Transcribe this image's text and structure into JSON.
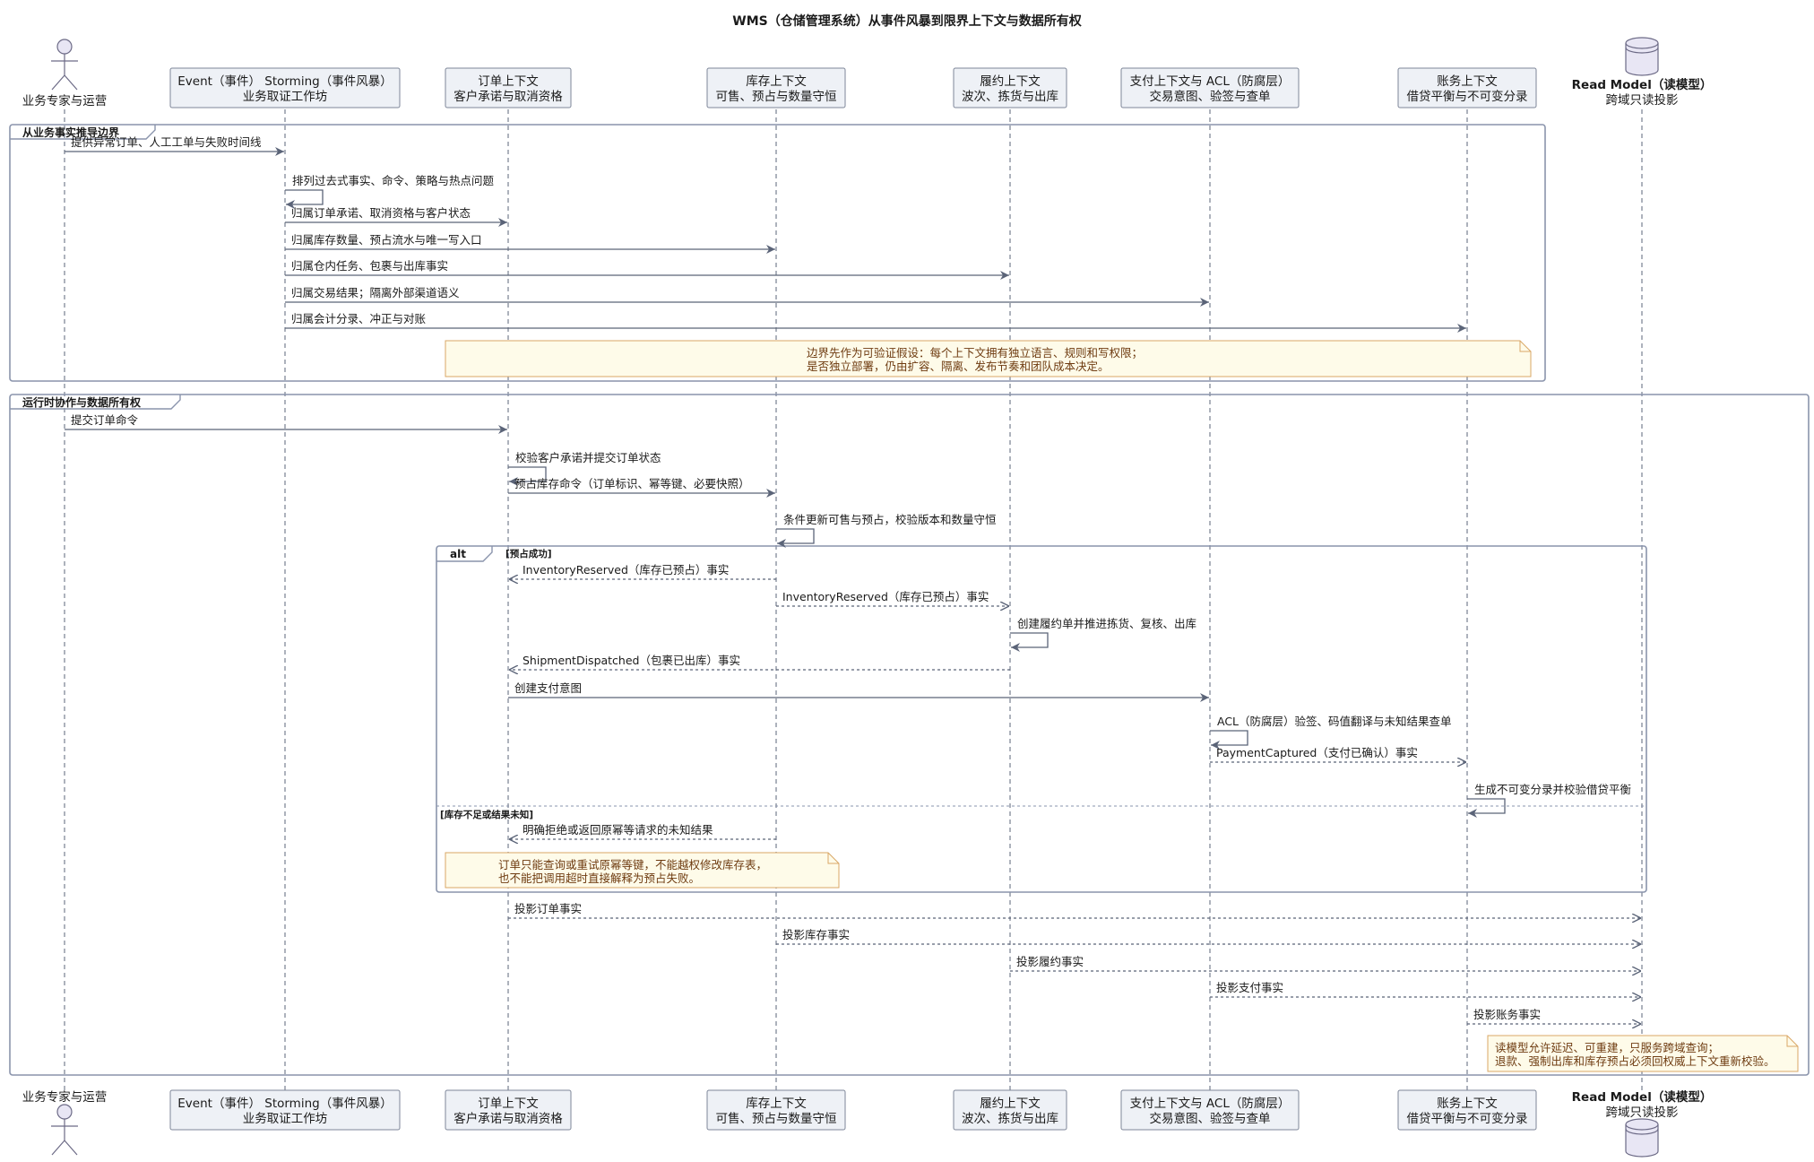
{
  "title": "WMS（仓储管理系统）从事件风暴到限界上下文与数据所有权",
  "participants": [
    {
      "id": "expert",
      "kind": "actor",
      "lines": [
        "业务专家与运营"
      ]
    },
    {
      "id": "es",
      "kind": "box",
      "lines": [
        "Event（事件） Storming（事件风暴）",
        "业务取证工作坊"
      ]
    },
    {
      "id": "order",
      "kind": "box",
      "lines": [
        "订单上下文",
        "客户承诺与取消资格"
      ]
    },
    {
      "id": "inv",
      "kind": "box",
      "lines": [
        "库存上下文",
        "可售、预占与数量守恒"
      ]
    },
    {
      "id": "ful",
      "kind": "box",
      "lines": [
        "履约上下文",
        "波次、拣货与出库"
      ]
    },
    {
      "id": "pay",
      "kind": "box",
      "lines": [
        "支付上下文与 ACL（防腐层）",
        "交易意图、验签与查单"
      ]
    },
    {
      "id": "acct",
      "kind": "box",
      "lines": [
        "账务上下文",
        "借贷平衡与不可变分录"
      ]
    },
    {
      "id": "rm",
      "kind": "database",
      "lines": [
        "Read Model（读模型）",
        "跨域只读投影"
      ]
    }
  ],
  "groups": [
    {
      "id": "g1",
      "label": "从业务事实推导边界"
    },
    {
      "id": "g2",
      "label": "运行时协作与数据所有权"
    }
  ],
  "alt": {
    "keyword": "alt",
    "conditions": [
      "[预占成功]",
      "[库存不足或结果未知]"
    ]
  },
  "messages": [
    {
      "from": "expert",
      "to": "es",
      "label": "提供异常订单、人工工单与失败时间线",
      "style": "solid"
    },
    {
      "from": "es",
      "to": "es",
      "label": "排列过去式事实、命令、策略与热点问题",
      "style": "solid"
    },
    {
      "from": "es",
      "to": "order",
      "label": "归属订单承诺、取消资格与客户状态",
      "style": "solid"
    },
    {
      "from": "es",
      "to": "inv",
      "label": "归属库存数量、预占流水与唯一写入口",
      "style": "solid"
    },
    {
      "from": "es",
      "to": "ful",
      "label": "归属仓内任务、包裹与出库事实",
      "style": "solid"
    },
    {
      "from": "es",
      "to": "pay",
      "label": "归属交易结果；隔离外部渠道语义",
      "style": "solid"
    },
    {
      "from": "es",
      "to": "acct",
      "label": "归属会计分录、冲正与对账",
      "style": "solid"
    },
    {
      "from": "expert",
      "to": "order",
      "label": "提交订单命令",
      "style": "solid"
    },
    {
      "from": "order",
      "to": "order",
      "label": "校验客户承诺并提交订单状态",
      "style": "solid"
    },
    {
      "from": "order",
      "to": "inv",
      "label": "预占库存命令（订单标识、幂等键、必要快照）",
      "style": "solid"
    },
    {
      "from": "inv",
      "to": "inv",
      "label": "条件更新可售与预占，校验版本和数量守恒",
      "style": "solid"
    },
    {
      "from": "inv",
      "to": "order",
      "label": "InventoryReserved（库存已预占）事实",
      "style": "dashed"
    },
    {
      "from": "inv",
      "to": "ful",
      "label": "InventoryReserved（库存已预占）事实",
      "style": "dashed"
    },
    {
      "from": "ful",
      "to": "ful",
      "label": "创建履约单并推进拣货、复核、出库",
      "style": "solid"
    },
    {
      "from": "ful",
      "to": "order",
      "label": "ShipmentDispatched（包裹已出库）事实",
      "style": "dashed"
    },
    {
      "from": "order",
      "to": "pay",
      "label": "创建支付意图",
      "style": "solid"
    },
    {
      "from": "pay",
      "to": "pay",
      "label": "ACL（防腐层）验签、码值翻译与未知结果查单",
      "style": "solid"
    },
    {
      "from": "pay",
      "to": "acct",
      "label": "PaymentCaptured（支付已确认）事实",
      "style": "dashed"
    },
    {
      "from": "acct",
      "to": "acct",
      "label": "生成不可变分录并校验借贷平衡",
      "style": "solid"
    },
    {
      "from": "inv",
      "to": "order",
      "label": "明确拒绝或返回原幂等请求的未知结果",
      "style": "dashed"
    },
    {
      "from": "order",
      "to": "rm",
      "label": "投影订单事实",
      "style": "dashed"
    },
    {
      "from": "inv",
      "to": "rm",
      "label": "投影库存事实",
      "style": "dashed"
    },
    {
      "from": "ful",
      "to": "rm",
      "label": "投影履约事实",
      "style": "dashed"
    },
    {
      "from": "pay",
      "to": "rm",
      "label": "投影支付事实",
      "style": "dashed"
    },
    {
      "from": "acct",
      "to": "rm",
      "label": "投影账务事实",
      "style": "dashed"
    }
  ],
  "notes": [
    {
      "id": "n1",
      "lines": [
        "边界先作为可验证假设：每个上下文拥有独立语言、规则和写权限；",
        "是否独立部署，仍由扩容、隔离、发布节奏和团队成本决定。"
      ]
    },
    {
      "id": "n2",
      "lines": [
        "订单只能查询或重试原幂等键，不能越权修改库存表，",
        "也不能把调用超时直接解释为预占失败。"
      ]
    },
    {
      "id": "n3",
      "lines": [
        "读模型允许延迟、可重建，只服务跨域查询；",
        "退款、强制出库和库存预占必须回权威上下文重新校验。"
      ]
    }
  ],
  "colors": {
    "line": "#5b6478",
    "boxFill": "#eef1f6",
    "boxStroke": "#7d8698",
    "noteFill": "#fefbe9",
    "noteStroke": "#d9a766",
    "noteText": "#6e3b10",
    "frame": "#8a94ac",
    "text": "#1a1a1a"
  }
}
